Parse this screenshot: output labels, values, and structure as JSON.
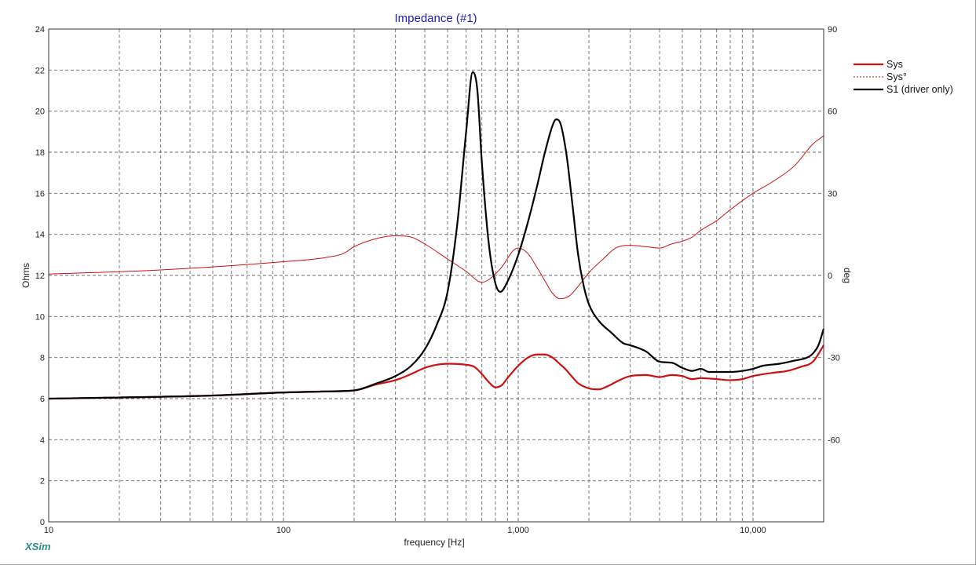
{
  "app": {
    "brand": "XSim"
  },
  "chart_data": {
    "type": "line",
    "title": "Impedance (#1)",
    "xlabel": "frequency [Hz]",
    "ylabel_left": "Ohms",
    "ylabel_right": "deg",
    "x_scale": "log",
    "xlim": [
      10,
      20000
    ],
    "ylim_left": [
      0,
      24
    ],
    "ylim_right": [
      -90,
      90
    ],
    "grid": true,
    "legend_position": "top-right",
    "x_ticks": [
      {
        "v": 10,
        "label": "10"
      },
      {
        "v": 100,
        "label": "100"
      },
      {
        "v": 1000,
        "label": "1,000"
      },
      {
        "v": 10000,
        "label": "10,000"
      }
    ],
    "y_ticks_left": [
      0,
      2,
      4,
      6,
      8,
      10,
      12,
      14,
      16,
      18,
      20,
      22,
      24
    ],
    "y_ticks_right": [
      90,
      60,
      30,
      0,
      -30,
      -60
    ],
    "series": [
      {
        "name": "Sys",
        "axis": "left",
        "color": "#d01010",
        "width": 2.2,
        "dash": "",
        "points": [
          [
            10,
            6.0
          ],
          [
            50,
            6.15
          ],
          [
            100,
            6.3
          ],
          [
            150,
            6.35
          ],
          [
            200,
            6.4
          ],
          [
            250,
            6.7
          ],
          [
            300,
            6.9
          ],
          [
            350,
            7.2
          ],
          [
            400,
            7.5
          ],
          [
            450,
            7.65
          ],
          [
            500,
            7.7
          ],
          [
            600,
            7.65
          ],
          [
            650,
            7.55
          ],
          [
            700,
            7.2
          ],
          [
            750,
            6.8
          ],
          [
            800,
            6.55
          ],
          [
            850,
            6.65
          ],
          [
            900,
            7.0
          ],
          [
            1000,
            7.6
          ],
          [
            1100,
            8.0
          ],
          [
            1200,
            8.15
          ],
          [
            1300,
            8.15
          ],
          [
            1400,
            8.0
          ],
          [
            1500,
            7.7
          ],
          [
            1600,
            7.4
          ],
          [
            1700,
            7.05
          ],
          [
            1800,
            6.75
          ],
          [
            2000,
            6.5
          ],
          [
            2200,
            6.45
          ],
          [
            2400,
            6.6
          ],
          [
            2700,
            6.9
          ],
          [
            3000,
            7.1
          ],
          [
            3500,
            7.15
          ],
          [
            4000,
            7.05
          ],
          [
            4500,
            7.15
          ],
          [
            5000,
            7.1
          ],
          [
            5500,
            6.95
          ],
          [
            6000,
            7.0
          ],
          [
            7000,
            6.95
          ],
          [
            8000,
            6.9
          ],
          [
            9000,
            6.95
          ],
          [
            10000,
            7.1
          ],
          [
            12000,
            7.25
          ],
          [
            14000,
            7.35
          ],
          [
            16000,
            7.55
          ],
          [
            18000,
            7.8
          ],
          [
            20000,
            8.6
          ]
        ]
      },
      {
        "name": "Sys°",
        "axis": "right",
        "color": "#d01010",
        "width": 1.0,
        "dash": "",
        "points": [
          [
            10,
            0.5
          ],
          [
            30,
            2.0
          ],
          [
            100,
            5.0
          ],
          [
            150,
            6.5
          ],
          [
            180,
            8.0
          ],
          [
            200,
            10.5
          ],
          [
            250,
            13.5
          ],
          [
            300,
            14.5
          ],
          [
            350,
            14.0
          ],
          [
            400,
            11.5
          ],
          [
            500,
            6.0
          ],
          [
            600,
            1.5
          ],
          [
            700,
            -2.5
          ],
          [
            750,
            -1.5
          ],
          [
            850,
            3.0
          ],
          [
            950,
            9.0
          ],
          [
            1000,
            10.0
          ],
          [
            1100,
            8.0
          ],
          [
            1200,
            3.0
          ],
          [
            1300,
            -2.0
          ],
          [
            1400,
            -6.5
          ],
          [
            1500,
            -8.5
          ],
          [
            1650,
            -7.5
          ],
          [
            1800,
            -4.0
          ],
          [
            2000,
            1.0
          ],
          [
            2300,
            6.0
          ],
          [
            2600,
            10.0
          ],
          [
            3000,
            11.0
          ],
          [
            3500,
            10.5
          ],
          [
            4000,
            10.0
          ],
          [
            4500,
            11.5
          ],
          [
            5000,
            12.5
          ],
          [
            5500,
            14.0
          ],
          [
            6000,
            16.5
          ],
          [
            7000,
            20.0
          ],
          [
            8000,
            24.0
          ],
          [
            10000,
            30.0
          ],
          [
            12000,
            34.0
          ],
          [
            15000,
            40.0
          ],
          [
            18000,
            48.0
          ],
          [
            20000,
            51.0
          ]
        ]
      },
      {
        "name": "S1 (driver only)",
        "axis": "left",
        "color": "#000000",
        "width": 2.2,
        "dash": "",
        "points": [
          [
            10,
            6.0
          ],
          [
            50,
            6.15
          ],
          [
            100,
            6.3
          ],
          [
            150,
            6.35
          ],
          [
            200,
            6.4
          ],
          [
            250,
            6.75
          ],
          [
            300,
            7.1
          ],
          [
            350,
            7.6
          ],
          [
            400,
            8.4
          ],
          [
            450,
            9.6
          ],
          [
            500,
            11.2
          ],
          [
            550,
            14.5
          ],
          [
            600,
            19.0
          ],
          [
            640,
            21.9
          ],
          [
            670,
            21.0
          ],
          [
            700,
            17.5
          ],
          [
            750,
            13.5
          ],
          [
            800,
            11.6
          ],
          [
            840,
            11.2
          ],
          [
            900,
            11.7
          ],
          [
            1000,
            13.0
          ],
          [
            1100,
            14.6
          ],
          [
            1200,
            16.3
          ],
          [
            1300,
            18.0
          ],
          [
            1400,
            19.3
          ],
          [
            1450,
            19.6
          ],
          [
            1500,
            19.5
          ],
          [
            1600,
            18.0
          ],
          [
            1700,
            15.5
          ],
          [
            1800,
            13.0
          ],
          [
            1900,
            11.5
          ],
          [
            2000,
            10.6
          ],
          [
            2200,
            9.8
          ],
          [
            2500,
            9.2
          ],
          [
            2800,
            8.7
          ],
          [
            3000,
            8.6
          ],
          [
            3500,
            8.3
          ],
          [
            4000,
            7.8
          ],
          [
            4500,
            7.75
          ],
          [
            5000,
            7.5
          ],
          [
            5500,
            7.35
          ],
          [
            6000,
            7.45
          ],
          [
            6500,
            7.3
          ],
          [
            7000,
            7.3
          ],
          [
            8000,
            7.3
          ],
          [
            9000,
            7.35
          ],
          [
            10000,
            7.45
          ],
          [
            11000,
            7.6
          ],
          [
            13000,
            7.7
          ],
          [
            15000,
            7.85
          ],
          [
            17000,
            8.0
          ],
          [
            18000,
            8.2
          ],
          [
            19000,
            8.6
          ],
          [
            20000,
            9.4
          ]
        ]
      }
    ]
  }
}
